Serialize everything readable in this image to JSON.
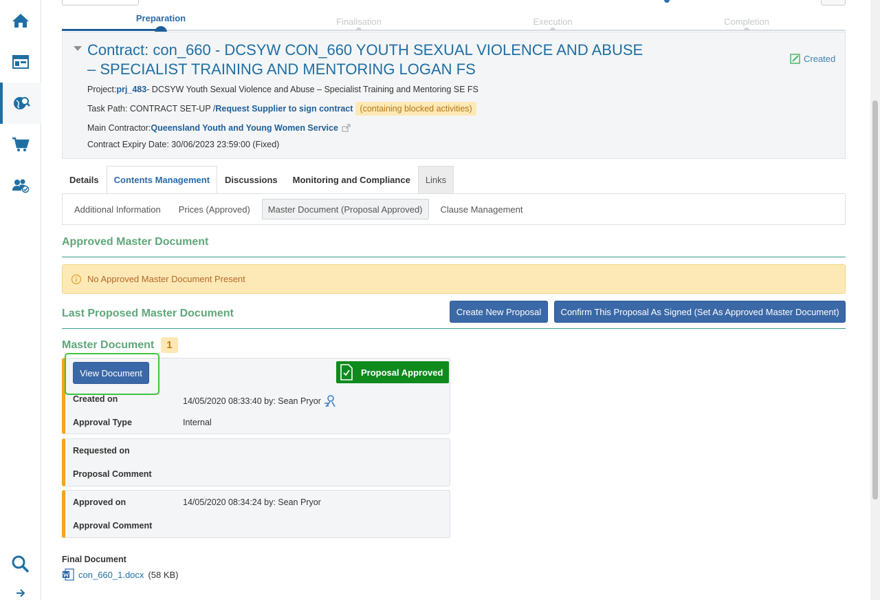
{
  "sidebar": {
    "items": [
      "home-icon",
      "dashboard-icon",
      "sourcing-icon",
      "cart-icon",
      "users-icon",
      "search-icon",
      "expand-arrow-icon"
    ]
  },
  "stepper": {
    "steps": [
      {
        "label": "Preparation",
        "state": "active"
      },
      {
        "label": "Finalisation",
        "state": "pending"
      },
      {
        "label": "Execution",
        "state": "pending"
      },
      {
        "label": "Completion",
        "state": "pending"
      }
    ]
  },
  "contract": {
    "title": "Contract: con_660 - DCSYW CON_660 YOUTH SEXUAL VIOLENCE AND ABUSE – SPECIALIST TRAINING AND MENTORING LOGAN FS",
    "status": "Created",
    "project_label": "Project:",
    "project_link": "prj_483",
    "project_desc": "- DCSYW Youth Sexual Violence and Abuse – Specialist Training and Mentoring SE FS",
    "task_path_label": "Task Path: CONTRACT SET-UP /",
    "task_path_link": "Request Supplier to sign contract",
    "task_path_note": "(containing blocked activities)",
    "main_contractor_label": "Main Contractor:",
    "main_contractor_link": "Queensland Youth and Young Women Service",
    "expiry": "Contract Expiry Date: 30/06/2023 23:59:00 (Fixed)"
  },
  "tabs": [
    {
      "label": "Details"
    },
    {
      "label": "Contents Management"
    },
    {
      "label": "Discussions"
    },
    {
      "label": "Monitoring and Compliance"
    },
    {
      "label": "Links"
    }
  ],
  "subtabs": [
    {
      "label": "Additional Information"
    },
    {
      "label": "Prices (Approved)"
    },
    {
      "label": "Master Document (Proposal Approved)"
    },
    {
      "label": "Clause Management"
    }
  ],
  "approved_section": {
    "title": "Approved Master Document",
    "alert": "No Approved Master Document Present"
  },
  "proposed_section": {
    "title": "Last Proposed Master Document",
    "create_button": "Create New Proposal",
    "confirm_button": "Confirm This Proposal As Signed (Set As Approved Master Document)"
  },
  "master_document": {
    "title": "Master Document",
    "count": "1",
    "view_button": "View Document",
    "status": "Proposal Approved",
    "created_on_label": "Created on",
    "created_on_value": "14/05/2020 08:33:40 by: Sean Pryor",
    "approval_type_label": "Approval Type",
    "approval_type_value": "Internal",
    "requested_on_label": "Requested on",
    "proposal_comment_label": "Proposal Comment",
    "approved_on_label": "Approved on",
    "approved_on_value": "14/05/2020 08:34:24 by: Sean Pryor",
    "approval_comment_label": "Approval Comment"
  },
  "final_document": {
    "label": "Final Document",
    "file_name": "con_660_1.docx",
    "file_size": "(58 KB)"
  },
  "colors": {
    "accent": "#1f6fa3",
    "section_green": "#5fa77a",
    "button_blue": "#3b69a7",
    "approved_green": "#0f8a1d",
    "warning_bg": "#fde9b5"
  }
}
